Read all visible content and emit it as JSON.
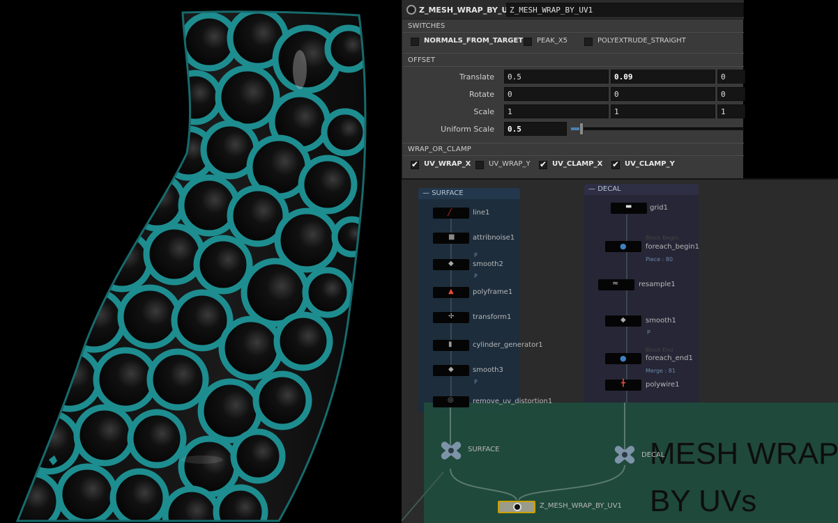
{
  "params": {
    "optype": "Z_MESH_WRAP_BY_UV",
    "node_name": "Z_MESH_WRAP_BY_UV1",
    "switches": {
      "title": "SWITCHES",
      "items": [
        {
          "label": "NORMALS_FROM_TARGET",
          "checked": false
        },
        {
          "label": "PEAK_X5",
          "checked": false
        },
        {
          "label": "POLYEXTRUDE_STRAIGHT",
          "checked": false
        }
      ]
    },
    "offset": {
      "title": "OFFSET",
      "translate": {
        "label": "Translate",
        "x": "0.5",
        "y": "0.09",
        "z": "0"
      },
      "rotate": {
        "label": "Rotate",
        "x": "0",
        "y": "0",
        "z": "0"
      },
      "scale": {
        "label": "Scale",
        "x": "1",
        "y": "1",
        "z": "1"
      },
      "uniform_scale": {
        "label": "Uniform Scale",
        "value": "0.5",
        "fraction": 0.05
      }
    },
    "wrap_or_clamp": {
      "title": "WRAP_OR_CLAMP",
      "items": [
        {
          "label": "UV_WRAP_X",
          "checked": true
        },
        {
          "label": "UV_WRAP_Y",
          "checked": false
        },
        {
          "label": "UV_CLAMP_X",
          "checked": true
        },
        {
          "label": "UV_CLAMP_Y",
          "checked": true
        }
      ]
    }
  },
  "network": {
    "surface_box": {
      "title": "SURFACE"
    },
    "decal_box": {
      "title": "DECAL"
    },
    "surface_nodes": [
      {
        "label": "line1"
      },
      {
        "label": "attribnoise1"
      },
      {
        "label": "smooth2"
      },
      {
        "label": "polyframe1"
      },
      {
        "label": "transform1"
      },
      {
        "label": "cylinder_generator1"
      },
      {
        "label": "smooth3"
      },
      {
        "label": "remove_uv_distortion1"
      }
    ],
    "surface_subtexts": [
      "P",
      "P",
      "P"
    ],
    "decal_nodes": [
      {
        "label": "grid1"
      },
      {
        "label": "foreach_begin1",
        "above": "Block Begin",
        "below": "Piece : 80"
      },
      {
        "label": "resample1"
      },
      {
        "label": "smooth1",
        "below": "P"
      },
      {
        "label": "foreach_end1",
        "above": "Block End",
        "below": "Merge : 81"
      },
      {
        "label": "polywire1"
      }
    ],
    "null_surface": "SURFACE",
    "null_decal": "DECAL",
    "hda_node": "Z_MESH_WRAP_BY_UV1",
    "sticky_line1": "MESH WRAP",
    "sticky_line2": "BY UVs"
  },
  "colors": {
    "mesh_teal": "#1f8a8c",
    "sticky_green": "#1f4b3c",
    "surface_box": "#1d2d3c",
    "decal_box": "#262637"
  }
}
